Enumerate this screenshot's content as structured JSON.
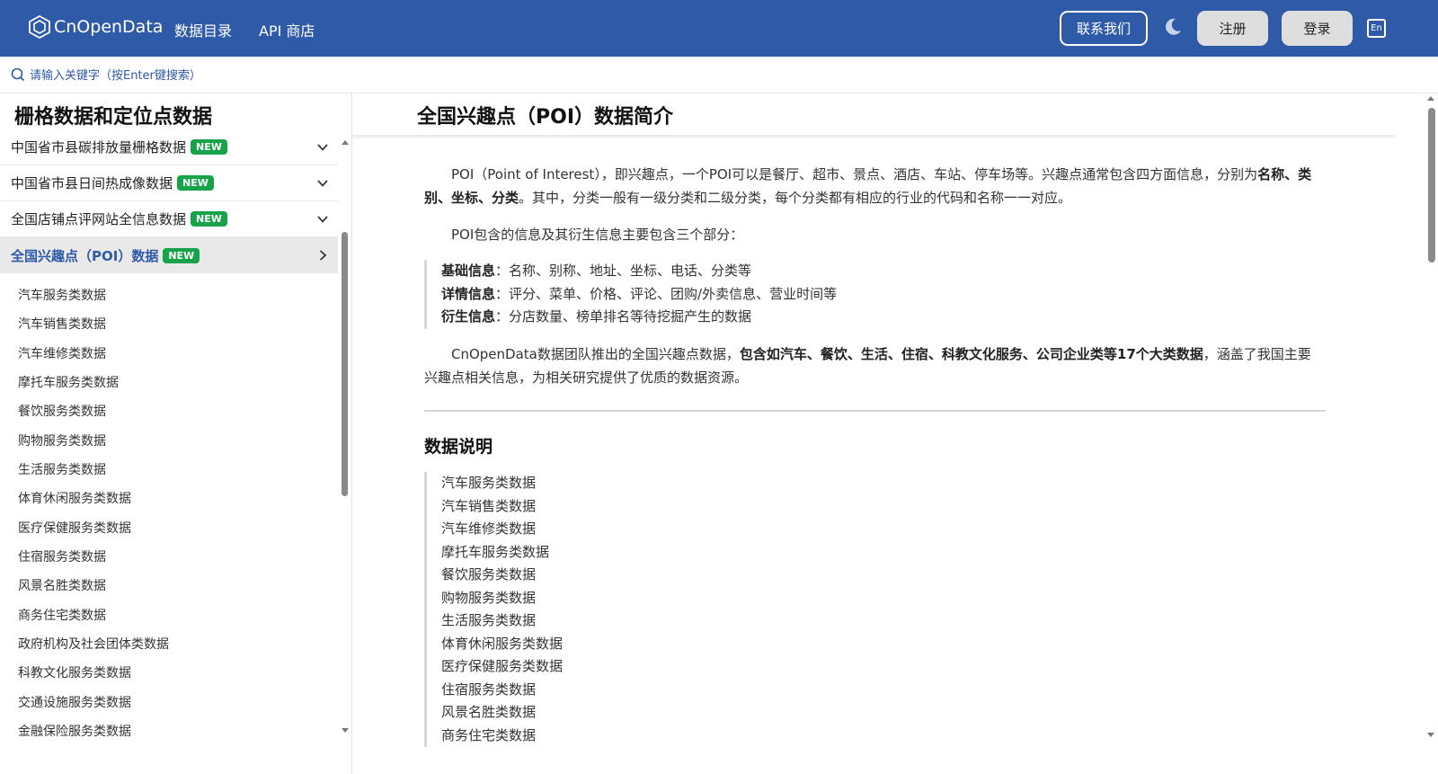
{
  "nav": {
    "logo_text": "CnOpenData",
    "links": [
      "数据目录",
      "API 商店"
    ],
    "contact_label": "联系我们",
    "register_label": "注册",
    "login_label": "登录",
    "lang_label": "En"
  },
  "search": {
    "placeholder": "请输入关键字（按Enter键搜索）"
  },
  "sidebar": {
    "title": "栅格数据和定位点数据",
    "badge": "NEW",
    "rows": [
      {
        "label": "中国省市县碳排放量栅格数据"
      },
      {
        "label": "中国省市县日间热成像数据"
      },
      {
        "label": "全国店铺点评网站全信息数据"
      },
      {
        "label": "全国兴趣点（POI）数据"
      }
    ],
    "sub_items": [
      "汽车服务类数据",
      "汽车销售类数据",
      "汽车维修类数据",
      "摩托车服务类数据",
      "餐饮服务类数据",
      "购物服务类数据",
      "生活服务类数据",
      "体育休闲服务类数据",
      "医疗保健服务类数据",
      "住宿服务类数据",
      "风景名胜类数据",
      "商务住宅类数据",
      "政府机构及社会团体类数据",
      "科教文化服务类数据",
      "交通设施服务类数据",
      "金融保险服务类数据"
    ]
  },
  "content": {
    "title": "全国兴趣点（POI）数据简介",
    "p1_a": "POI（Point of Interest），即兴趣点，一个POI可以是餐厅、超市、景点、酒店、车站、停车场等。兴趣点通常包含四方面信息，分别为",
    "p1_b": "名称、类别、坐标、分类",
    "p1_c": "。其中，分类一般有一级分类和二级分类，每个分类都有相应的行业的代码和名称一一对应。",
    "p2": "POI包含的信息及其衍生信息主要包含三个部分：",
    "info": [
      {
        "label": "基础信息",
        "text": "：名称、别称、地址、坐标、电话、分类等"
      },
      {
        "label": "详情信息",
        "text": "：评分、菜单、价格、评论、团购/外卖信息、营业时间等"
      },
      {
        "label": "衍生信息",
        "text": "：分店数量、榜单排名等待挖掘产生的数据"
      }
    ],
    "p3_a": "CnOpenData数据团队推出的全国兴趣点数据，",
    "p3_b": "包含如汽车、餐饮、生活、住宿、科教文化服务、公司企业类等17个大类数据",
    "p3_c": "，涵盖了我国主要兴趣点相关信息，为相关研究提供了优质的数据资源。",
    "section_title": "数据说明",
    "categories": [
      "汽车服务类数据",
      "汽车销售类数据",
      "汽车维修类数据",
      "摩托车服务类数据",
      "餐饮服务类数据",
      "购物服务类数据",
      "生活服务类数据",
      "体育休闲服务类数据",
      "医疗保健服务类数据",
      "住宿服务类数据",
      "风景名胜类数据",
      "商务住宅类数据"
    ]
  },
  "colors": {
    "brand": "#2f5aa8",
    "badge": "#16a34a"
  }
}
